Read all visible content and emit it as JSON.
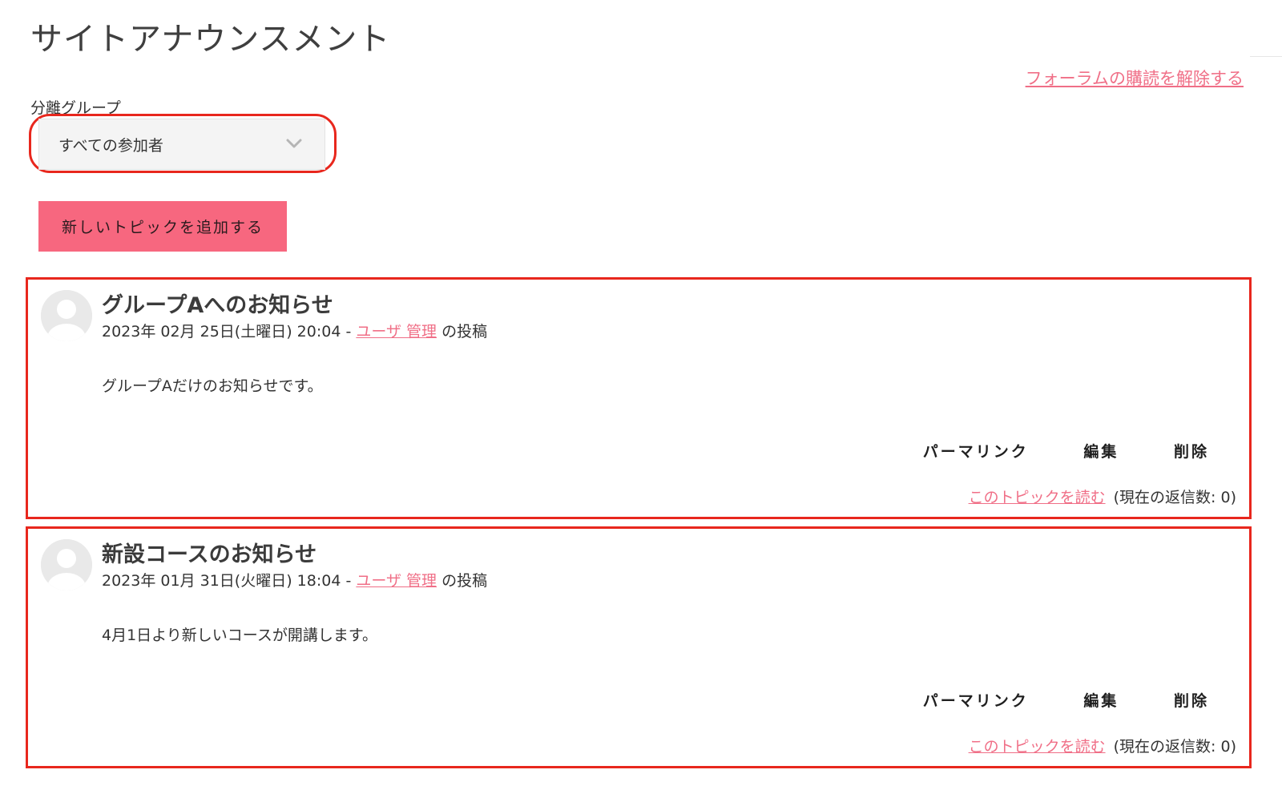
{
  "page": {
    "title": "サイトアナウンスメント",
    "unsubscribe_label": "フォーラムの購読を解除する"
  },
  "group_filter": {
    "label": "分離グループ",
    "selected": "すべての参加者"
  },
  "add_topic_label": "新しいトピックを追加する",
  "colors": {
    "accent": "#f7677f",
    "link": "#f06f87",
    "highlight_border": "#e8271d"
  },
  "posts": [
    {
      "title": "グループAへのお知らせ",
      "date": "2023年 02月 25日(土曜日) 20:04 -",
      "author": "ユーザ 管理",
      "posted_suffix": "の投稿",
      "body": "グループAだけのお知らせです。",
      "actions": {
        "permalink": "パーマリンク",
        "edit": "編集",
        "delete": "削除"
      },
      "read_link": "このトピックを読む",
      "reply_count": "(現在の返信数: 0)"
    },
    {
      "title": "新設コースのお知らせ",
      "date": "2023年 01月 31日(火曜日) 18:04 -",
      "author": "ユーザ 管理",
      "posted_suffix": "の投稿",
      "body": "4月1日より新しいコースが開講します。",
      "actions": {
        "permalink": "パーマリンク",
        "edit": "編集",
        "delete": "削除"
      },
      "read_link": "このトピックを読む",
      "reply_count": "(現在の返信数: 0)"
    }
  ]
}
